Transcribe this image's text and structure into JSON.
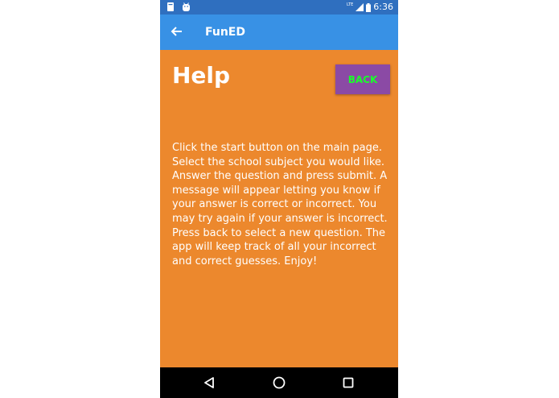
{
  "status_bar": {
    "network_label": "LTE",
    "time": "6:36",
    "icons": [
      "notification-icon",
      "android-icon",
      "signal-icon",
      "battery-icon"
    ]
  },
  "app_bar": {
    "title": "FunED",
    "back_icon": "arrow-left-icon"
  },
  "page": {
    "title": "Help",
    "back_button_label": "BACK",
    "help_text": "Click the start button on the main page. Select the school subject you would like. Answer the question and press submit. A message will appear letting you know if your answer is correct or incorrect. You may try again if your answer is incorrect. Press back to select a new question. The app will keep track of all your incorrect and correct guesses. Enjoy!"
  },
  "nav_bar": {
    "icons": [
      "back-triangle-icon",
      "home-circle-icon",
      "recents-square-icon"
    ]
  },
  "colors": {
    "status_bar": "#2f6fbf",
    "app_bar": "#3891e5",
    "background": "#ec882d",
    "button_bg": "#8b4aa5",
    "button_text": "#19ff2a"
  }
}
